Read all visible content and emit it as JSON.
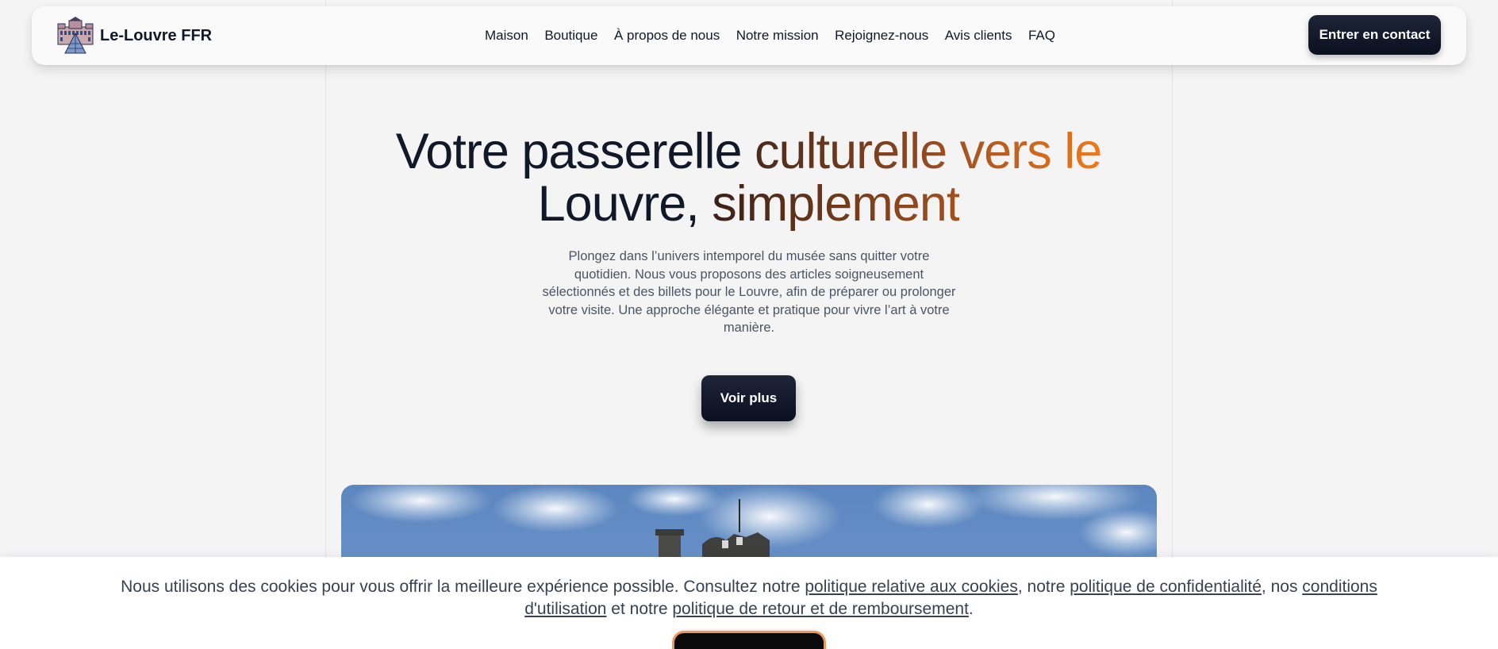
{
  "brand": {
    "name": "Le-Louvre FFR",
    "logo_icon": "louvre-palace-logo"
  },
  "nav": {
    "items": [
      {
        "label": "Maison"
      },
      {
        "label": "Boutique"
      },
      {
        "label": "À propos de nous"
      },
      {
        "label": "Notre mission"
      },
      {
        "label": "Rejoignez-nous"
      },
      {
        "label": "Avis clients"
      },
      {
        "label": "FAQ"
      }
    ],
    "contact_label": "Entrer en contact"
  },
  "hero": {
    "title_part1": "Votre passerelle ",
    "title_part2": "culturelle vers le",
    "title_part3": "Louvre, ",
    "title_part4": "simplement",
    "description": "Plongez dans l’univers intemporel du musée sans quitter votre quotidien. Nous vous proposons des articles soigneusement sélectionnés et des billets pour le Louvre, afin de préparer ou prolonger votre visite. Une approche élégante et pratique pour vivre l’art à votre manière.",
    "cta_label": "Voir plus"
  },
  "cookie": {
    "text_1": "Nous utilisons des cookies pour vous offrir la meilleure expérience possible. Consultez notre ",
    "link_cookies": "politique relative aux cookies",
    "text_2": ", notre ",
    "link_privacy": "politique de confidentialité",
    "text_3": ", nos ",
    "link_terms": "conditions d'utilisation",
    "text_4": " et notre ",
    "link_refund": "politique de retour et de remboursement",
    "text_5": "."
  },
  "colors": {
    "accent_dark": "#0b1020",
    "gradient_start": "#4a2a1c",
    "gradient_end": "#f07a1a",
    "cookie_button_glow": "#e89a61"
  }
}
